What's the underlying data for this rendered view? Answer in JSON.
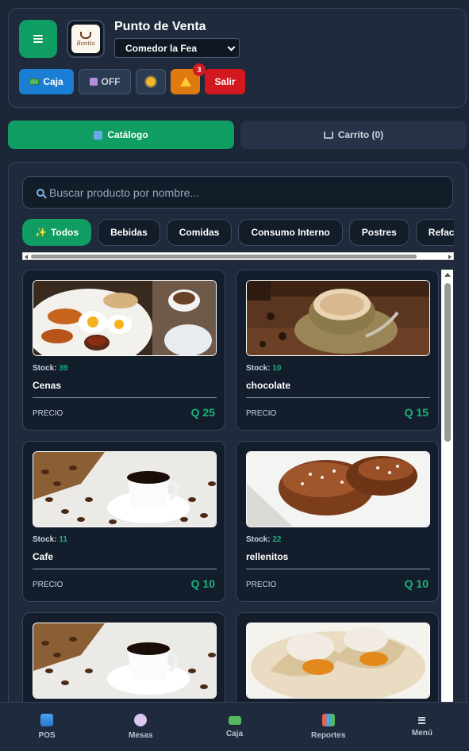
{
  "header": {
    "title": "Punto de Venta",
    "location": "Comedor la Fea",
    "logo_text": "Bonita",
    "buttons": {
      "caja": "Caja",
      "off": "OFF",
      "salir": "Salir"
    },
    "alert_count": "3"
  },
  "tabs": {
    "catalog": "Catálogo",
    "cart": "Carrito (0)"
  },
  "search": {
    "placeholder": "Buscar producto por nombre..."
  },
  "categories": [
    "Todos",
    "Bebidas",
    "Comidas",
    "Consumo Interno",
    "Postres",
    "Refacciones"
  ],
  "product_labels": {
    "stock": "Stock:",
    "price": "PRECIO"
  },
  "products": [
    {
      "name": "Cenas",
      "stock": "39",
      "price": "Q 25"
    },
    {
      "name": "chocolate",
      "stock": "10",
      "price": "Q 15"
    },
    {
      "name": "Cafe",
      "stock": "11",
      "price": "Q 10"
    },
    {
      "name": "rellenitos",
      "stock": "22",
      "price": "Q 10"
    },
    {
      "name": "",
      "stock": "",
      "price": ""
    },
    {
      "name": "",
      "stock": "",
      "price": ""
    }
  ],
  "nav": {
    "pos": "POS",
    "mesas": "Mesas",
    "caja": "Caja",
    "reportes": "Reportes",
    "menu": "Menú"
  },
  "colors": {
    "accent": "#0f9d63",
    "caja_button": "#1a7ed4",
    "alert_button": "#e07a10",
    "exit_button": "#d31920",
    "price_text": "#18b27a"
  }
}
